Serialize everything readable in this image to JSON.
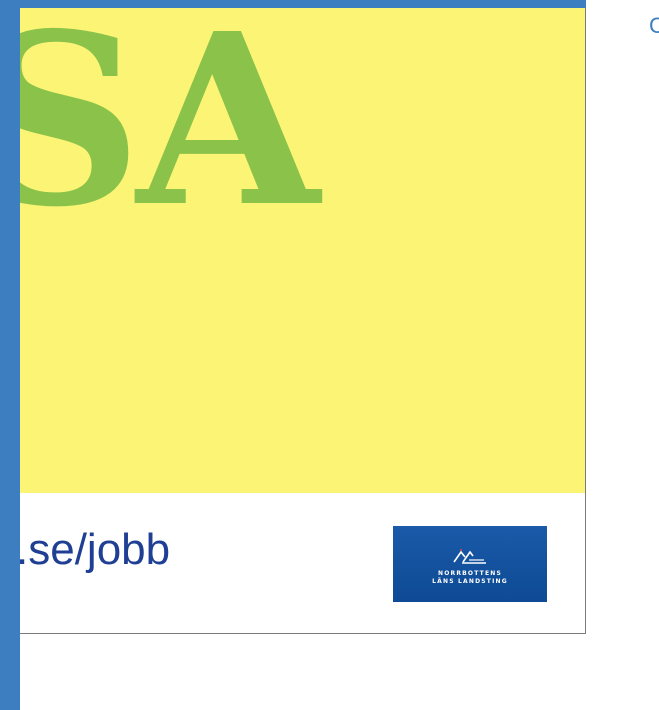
{
  "ad": {
    "headline": "SA",
    "url": ".se/jobb",
    "logo": {
      "line1": "NORRBOTTENS",
      "line2": "LÄNS LANDSTING",
      "icon": "norrbotten-mountain-logo-icon"
    }
  },
  "corner": {
    "text": "C"
  },
  "colors": {
    "frame_blue": "#3d7ec0",
    "yellow_background": "#fcf474",
    "headline_green": "#8bc34a",
    "url_blue": "#1f3f94",
    "logo_blue": "#0e4a95"
  }
}
